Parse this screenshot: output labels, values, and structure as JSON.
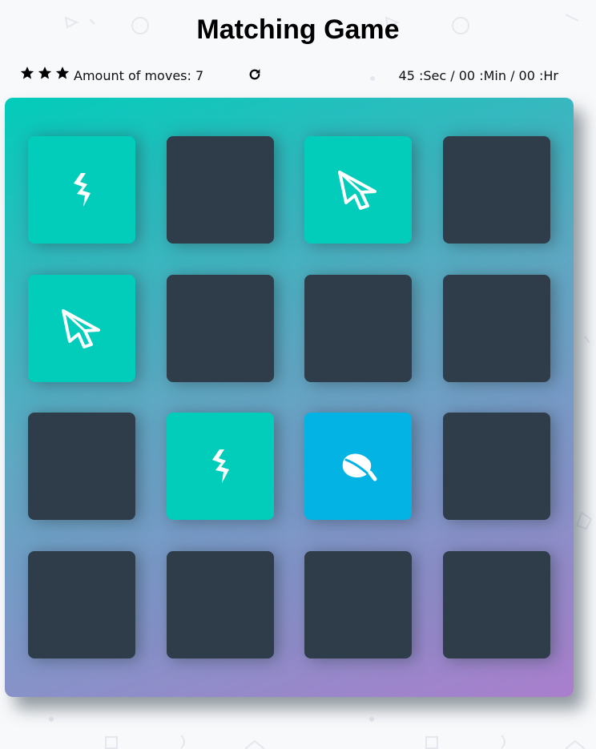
{
  "title": "Matching Game",
  "score": {
    "stars": 3,
    "moves_label": "Amount of moves:",
    "moves": "7"
  },
  "timer": {
    "seconds": "45",
    "sec_label": ":Sec",
    "minutes": "00",
    "min_label": ":Min",
    "hours": "00",
    "hr_label": ":Hr"
  },
  "colors": {
    "card_back": "#2e3d49",
    "card_matched": "#02ccba",
    "card_shown": "#02b3e4",
    "deck_gradient_start": "#02ccba",
    "deck_gradient_end": "#aa7ecd"
  },
  "deck": {
    "rows": 4,
    "cols": 4,
    "cards": [
      {
        "state": "match",
        "icon": "bolt-icon"
      },
      {
        "state": "closed",
        "icon": ""
      },
      {
        "state": "match",
        "icon": "paper-plane-icon"
      },
      {
        "state": "closed",
        "icon": ""
      },
      {
        "state": "match",
        "icon": "paper-plane-icon"
      },
      {
        "state": "closed",
        "icon": ""
      },
      {
        "state": "closed",
        "icon": ""
      },
      {
        "state": "closed",
        "icon": ""
      },
      {
        "state": "closed",
        "icon": ""
      },
      {
        "state": "match",
        "icon": "bolt-icon"
      },
      {
        "state": "show",
        "icon": "leaf-icon"
      },
      {
        "state": "closed",
        "icon": ""
      },
      {
        "state": "closed",
        "icon": ""
      },
      {
        "state": "closed",
        "icon": ""
      },
      {
        "state": "closed",
        "icon": ""
      },
      {
        "state": "closed",
        "icon": ""
      }
    ]
  }
}
